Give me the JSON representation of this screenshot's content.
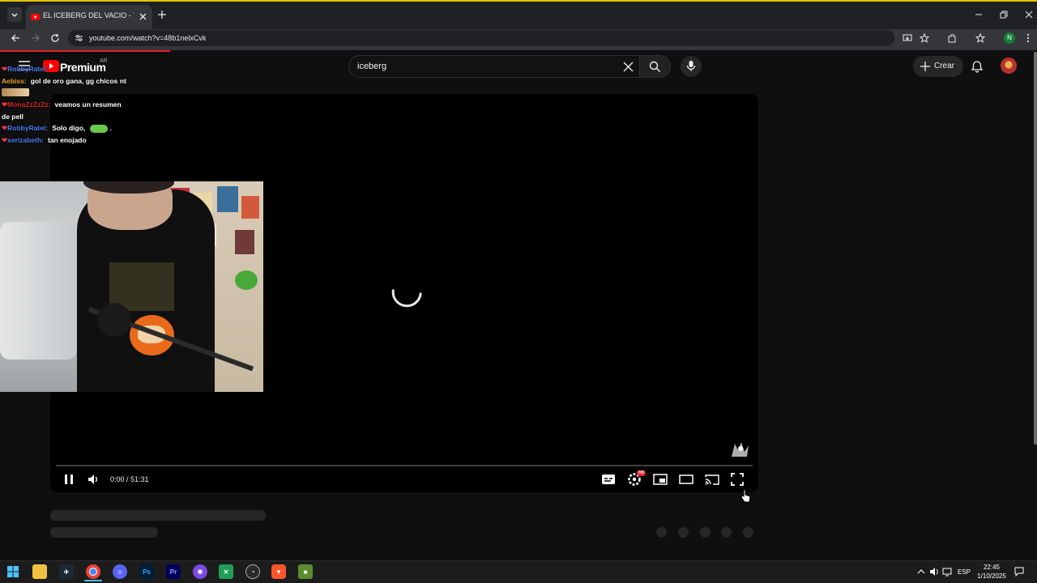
{
  "browser": {
    "tab_title": "EL ICEBERG DEL VACIO - YouTube",
    "url": "youtube.com/watch?v=48b1nelxCvk",
    "profile_initial": "N"
  },
  "youtube": {
    "logo_text": "Premium",
    "country_code": "AR",
    "search_value": "iceberg",
    "create_label": "Crear"
  },
  "player": {
    "time_display": "0:00 / 51:31",
    "settings_badge": "HD"
  },
  "chat": [
    {
      "user": "RobbyRatel:",
      "message": "",
      "user_color": "#4a7bf0",
      "badge_color": "#e8334a"
    },
    {
      "user": "Aebiss:",
      "message": "gol de oro gana, gg chicos nt",
      "user_color": "#f0a020",
      "badge_color": ""
    },
    {
      "user": "MonaZzZzZz:",
      "message": "veamos un resumen",
      "message_cont": "de pell",
      "user_color": "#d8202a",
      "badge_color": "#e8334a"
    },
    {
      "user": "RobbyRatel:",
      "message": "Solo digo,",
      "message_tail": ".",
      "user_color": "#4a7bf0",
      "badge_color": "#e8334a"
    },
    {
      "user": "xerizabeth:",
      "message": "tan enojado",
      "user_color": "#4a7bf0",
      "badge_color": "#e8334a"
    }
  ],
  "taskbar": {
    "language": "ESP",
    "time": "22:45",
    "date": "1/10/2025",
    "apps": [
      "Ps",
      "Pr"
    ]
  }
}
